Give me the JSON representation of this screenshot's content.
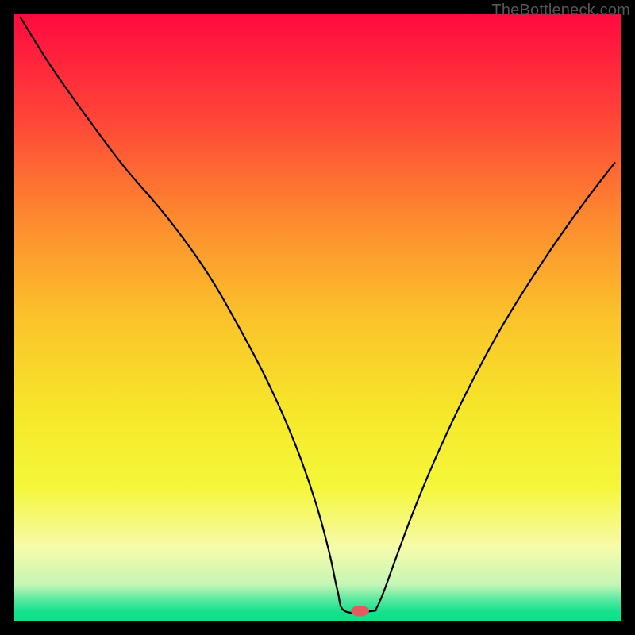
{
  "watermark": "TheBottleneck.com",
  "chart_data": {
    "type": "line",
    "title": "",
    "xlabel": "",
    "ylabel": "",
    "xlim": [
      0,
      100
    ],
    "ylim": [
      0,
      100
    ],
    "background_gradient": [
      {
        "pos": 0.0,
        "color": "#ff0a3f"
      },
      {
        "pos": 0.17,
        "color": "#ff4438"
      },
      {
        "pos": 0.34,
        "color": "#fd8b2f"
      },
      {
        "pos": 0.5,
        "color": "#fbc32b"
      },
      {
        "pos": 0.66,
        "color": "#f6e82a"
      },
      {
        "pos": 0.78,
        "color": "#f5f73a"
      },
      {
        "pos": 0.88,
        "color": "#f6fbab"
      },
      {
        "pos": 0.94,
        "color": "#c5f6b4"
      },
      {
        "pos": 0.965,
        "color": "#5ae9a2"
      },
      {
        "pos": 0.985,
        "color": "#14e28c"
      },
      {
        "pos": 1.0,
        "color": "#0ee18a"
      }
    ],
    "series": [
      {
        "name": "bottleneck-curve",
        "x": [
          1.0,
          6.0,
          12.0,
          18.0,
          24.0,
          29.0,
          33.0,
          37.0,
          41.0,
          44.5,
          47.5,
          50.0,
          52.0,
          53.3,
          54.5,
          59.0,
          59.8,
          61.0,
          63.0,
          66.0,
          70.0,
          75.0,
          81.0,
          88.0,
          94.0,
          99.0
        ],
        "y": [
          99.5,
          91.5,
          83.0,
          75.0,
          68.0,
          61.5,
          55.5,
          48.5,
          41.0,
          33.5,
          26.0,
          18.5,
          11.0,
          5.0,
          1.6,
          1.6,
          2.2,
          5.0,
          10.5,
          18.5,
          28.0,
          38.5,
          49.5,
          60.5,
          69.0,
          75.5
        ]
      }
    ],
    "marker": {
      "x": 57.0,
      "y": 1.6,
      "rx": 1.5,
      "ry": 0.9,
      "color": "#e55a5f"
    }
  }
}
